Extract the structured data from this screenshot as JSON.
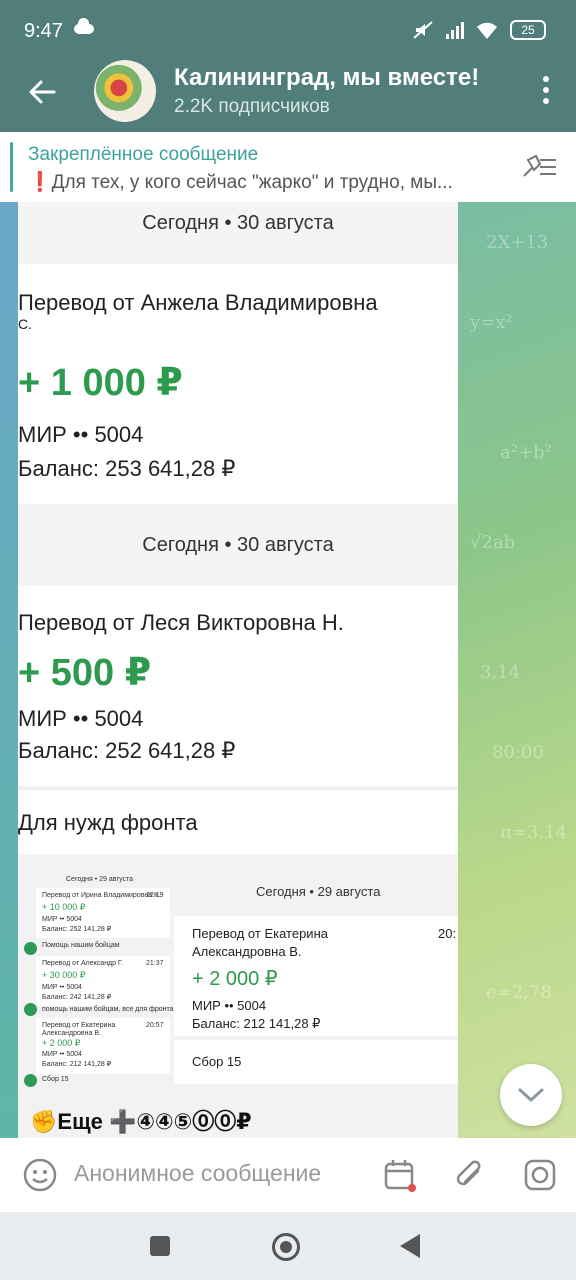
{
  "status": {
    "time": "9:47",
    "battery": "25"
  },
  "header": {
    "title": "Калининград, мы вместе!",
    "subscribers": "2.2K подписчиков"
  },
  "pinned": {
    "title": "Закреплённое сообщение",
    "text": "❗️Для тех, у кого сейчас \"жарко\" и трудно, мы..."
  },
  "receipt1": {
    "date": "Сегодня • 30 августа",
    "from": "Перевод от Анжела Владимировна",
    "from_cont": "С.",
    "amount": "+ 1 000 ₽",
    "card": "МИР •• 5004",
    "balance": "Баланс: 253 641,28 ₽"
  },
  "receipt2": {
    "date": "Сегодня • 30 августа",
    "from": "Перевод от Леся Викторовна Н.",
    "amount": "+ 500 ₽",
    "card": "МИР •• 5004",
    "balance": "Баланс: 252 641,28 ₽",
    "note": "Для нужд фронта"
  },
  "mini": {
    "date": "Сегодня • 29 августа",
    "r1_from": "Перевод от Ирина Владимировна К.",
    "r1_time": "22:19",
    "r1_amount": "+ 10 000 ₽",
    "r1_card": "МИР •• 5004",
    "r1_balance": "Баланс: 252 141,28 ₽",
    "r1_note": "Помощь нашим бойцам",
    "r2_from": "Перевод от Александр Г.",
    "r2_time": "21:37",
    "r2_amount": "+ 30 000 ₽",
    "r2_card": "МИР •• 5004",
    "r2_balance": "Баланс: 242 141,28 ₽",
    "r2_note": "помощь нашим бойцам, все для фронта",
    "r3_from": "Перевод от Екатерина",
    "r3_from2": "Александровна В.",
    "r3_time": "20:57",
    "r3_amount": "+ 2 000 ₽",
    "r3_card": "МИР •• 5004",
    "r3_balance": "Баланс: 212 141,28 ₽",
    "r3_note": "Сбор 15"
  },
  "receipt3": {
    "date": "Сегодня • 29 августа",
    "from": "Перевод от Екатерина",
    "from2": "Александровна В.",
    "time": "20:",
    "amount": "+ 2 000 ₽",
    "card": "МИР •• 5004",
    "balance": "Баланс: 212 141,28 ₽",
    "note": "Сбор 15"
  },
  "message": {
    "text": "✊Еще ➕④④⑤⓪⓪₽"
  },
  "input": {
    "placeholder": "Анонимное сообщение"
  }
}
